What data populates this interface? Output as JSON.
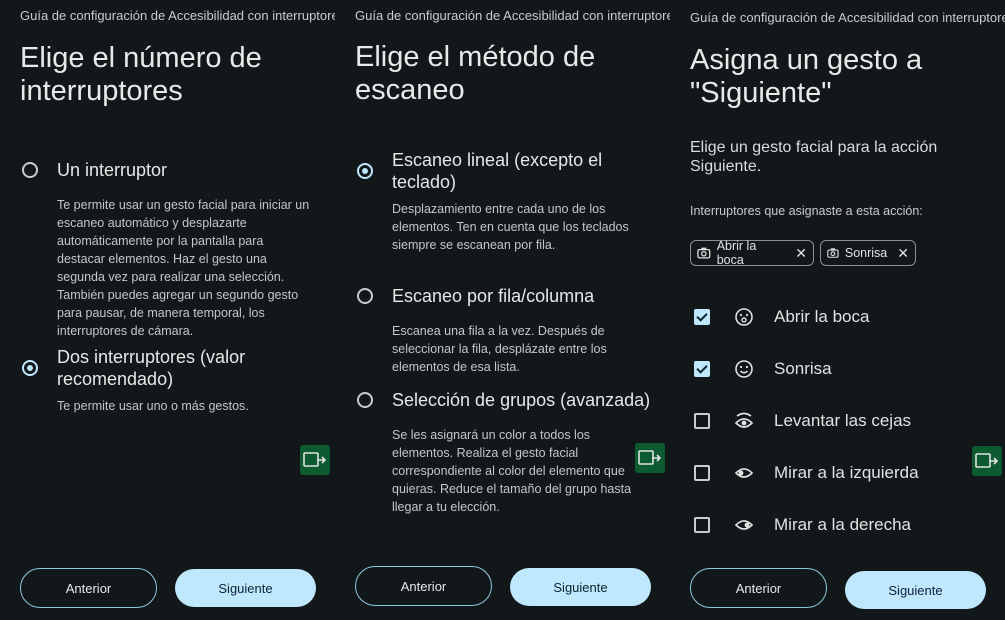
{
  "panel1": {
    "app_title": "Guía de configuración de Accesibilidad con interruptores",
    "heading": "Elige el número de interruptores",
    "options": [
      {
        "label": "Un interruptor",
        "selected": false,
        "description": "Te permite usar un gesto facial para iniciar un escaneo automático y desplazarte automáticamente por la pantalla para destacar elementos. Haz el gesto una segunda vez para realizar una selección. También puedes agregar un segundo gesto para pausar, de manera temporal, los interruptores de cámara."
      },
      {
        "label": "Dos interruptores (valor recomendado)",
        "selected": true,
        "description": "Te permite usar uno o más gestos."
      }
    ],
    "prev_label": "Anterior",
    "next_label": "Siguiente"
  },
  "panel2": {
    "app_title": "Guía de configuración de Accesibilidad con interruptores",
    "heading": "Elige el método de escaneo",
    "options": [
      {
        "label": "Escaneo lineal (excepto el teclado)",
        "selected": true,
        "description": "Desplazamiento entre cada uno de los elementos. Ten en cuenta que los teclados siempre se escanean por fila."
      },
      {
        "label": "Escaneo por fila/columna",
        "selected": false,
        "description": "Escanea una fila a la vez. Después de seleccionar la fila, desplázate entre los elementos de esa lista."
      },
      {
        "label": "Selección de grupos (avanzada)",
        "selected": false,
        "description": "Se les asignará un color a todos los elementos. Realiza el gesto facial correspondiente al color del elemento que quieras. Reduce el tamaño del grupo hasta llegar a tu elección."
      }
    ],
    "prev_label": "Anterior",
    "next_label": "Siguiente"
  },
  "panel3": {
    "app_title": "Guía de configuración de Accesibilidad con interruptores",
    "heading": "Asigna un gesto a \"Siguiente\"",
    "subtext": "Elige un gesto facial para la acción Siguiente.",
    "assigned_label": "Interruptores que asignaste a esta acción:",
    "chips": [
      {
        "label": "Abrir la boca",
        "icon": "camera-icon"
      },
      {
        "label": "Sonrisa",
        "icon": "camera-icon"
      }
    ],
    "gestures": [
      {
        "label": "Abrir la boca",
        "checked": true,
        "icon": "open-mouth-face-icon"
      },
      {
        "label": "Sonrisa",
        "checked": true,
        "icon": "smile-face-icon"
      },
      {
        "label": "Levantar las cejas",
        "checked": false,
        "icon": "raised-eyebrows-eye-icon"
      },
      {
        "label": "Mirar a la izquierda",
        "checked": false,
        "icon": "look-left-eye-icon"
      },
      {
        "label": "Mirar a la derecha",
        "checked": false,
        "icon": "look-right-eye-icon"
      }
    ],
    "prev_label": "Anterior",
    "next_label": "Siguiente"
  },
  "colors": {
    "background": "#121719",
    "accent": "#bfe8ff",
    "outline": "#8fc7de",
    "fab": "#0c5a2f"
  }
}
